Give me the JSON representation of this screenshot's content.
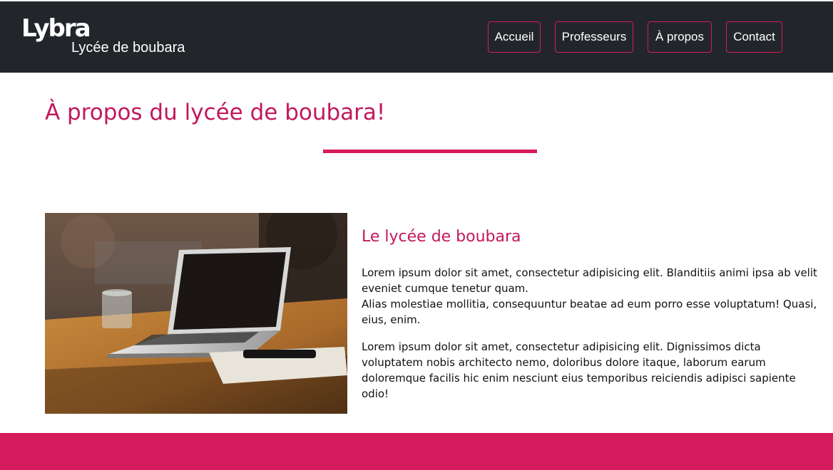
{
  "brand": {
    "logo": "Lybra",
    "tagline": "Lycée de boubara"
  },
  "nav": {
    "items": [
      {
        "label": "Accueil"
      },
      {
        "label": "Professeurs"
      },
      {
        "label": "À propos"
      },
      {
        "label": "Contact"
      }
    ]
  },
  "page": {
    "title": "À propos du lycée de boubara!"
  },
  "about": {
    "heading": "Le lycée de boubara",
    "para1_line1": "Lorem ipsum dolor sit amet, consectetur adipisicing elit. Blanditiis animi ipsa ab velit eveniet cumque tenetur quam.",
    "para1_line2": "Alias molestiae mollitia, consequuntur beatae ad eum porro esse voluptatum! Quasi, eius, enim.",
    "para2": "Lorem ipsum dolor sit amet, consectetur adipisicing elit. Dignissimos dicta voluptatem nobis architecto nemo, doloribus dolore itaque, laborum earum doloremque facilis hic enim nesciunt eius temporibus reiciendis adipisci sapiente odio!"
  },
  "colors": {
    "accent": "#d51b5b",
    "heading": "#c2185b",
    "topbar": "#22262a"
  }
}
